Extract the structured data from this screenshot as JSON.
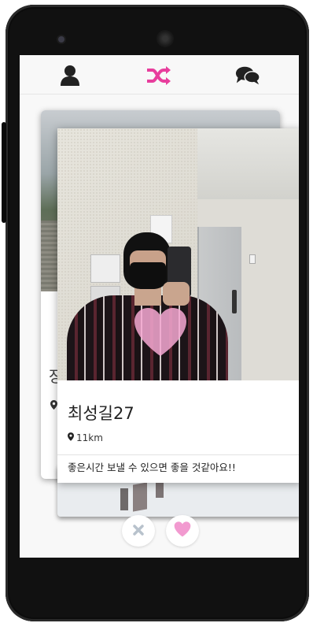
{
  "nav": {
    "profile_icon": "user-icon",
    "shuffle_icon": "shuffle-icon",
    "chat_icon": "chat-bubbles-icon",
    "active_color": "#e83e9d",
    "icon_color": "#222222"
  },
  "back_card": {
    "name_partial": "장",
    "location_icon": "map-pin-icon"
  },
  "profile": {
    "name": "최성길27",
    "distance": "11km",
    "bio": "좋은시간 보낼 수 있으면 좋을 것같아요!!"
  },
  "actions": {
    "dislike_icon": "x-icon",
    "like_icon": "heart-icon",
    "like_color": "#f29ad0",
    "dislike_color": "#b8c2cc"
  },
  "overlay": {
    "heart_color": "#f6a9d3"
  }
}
